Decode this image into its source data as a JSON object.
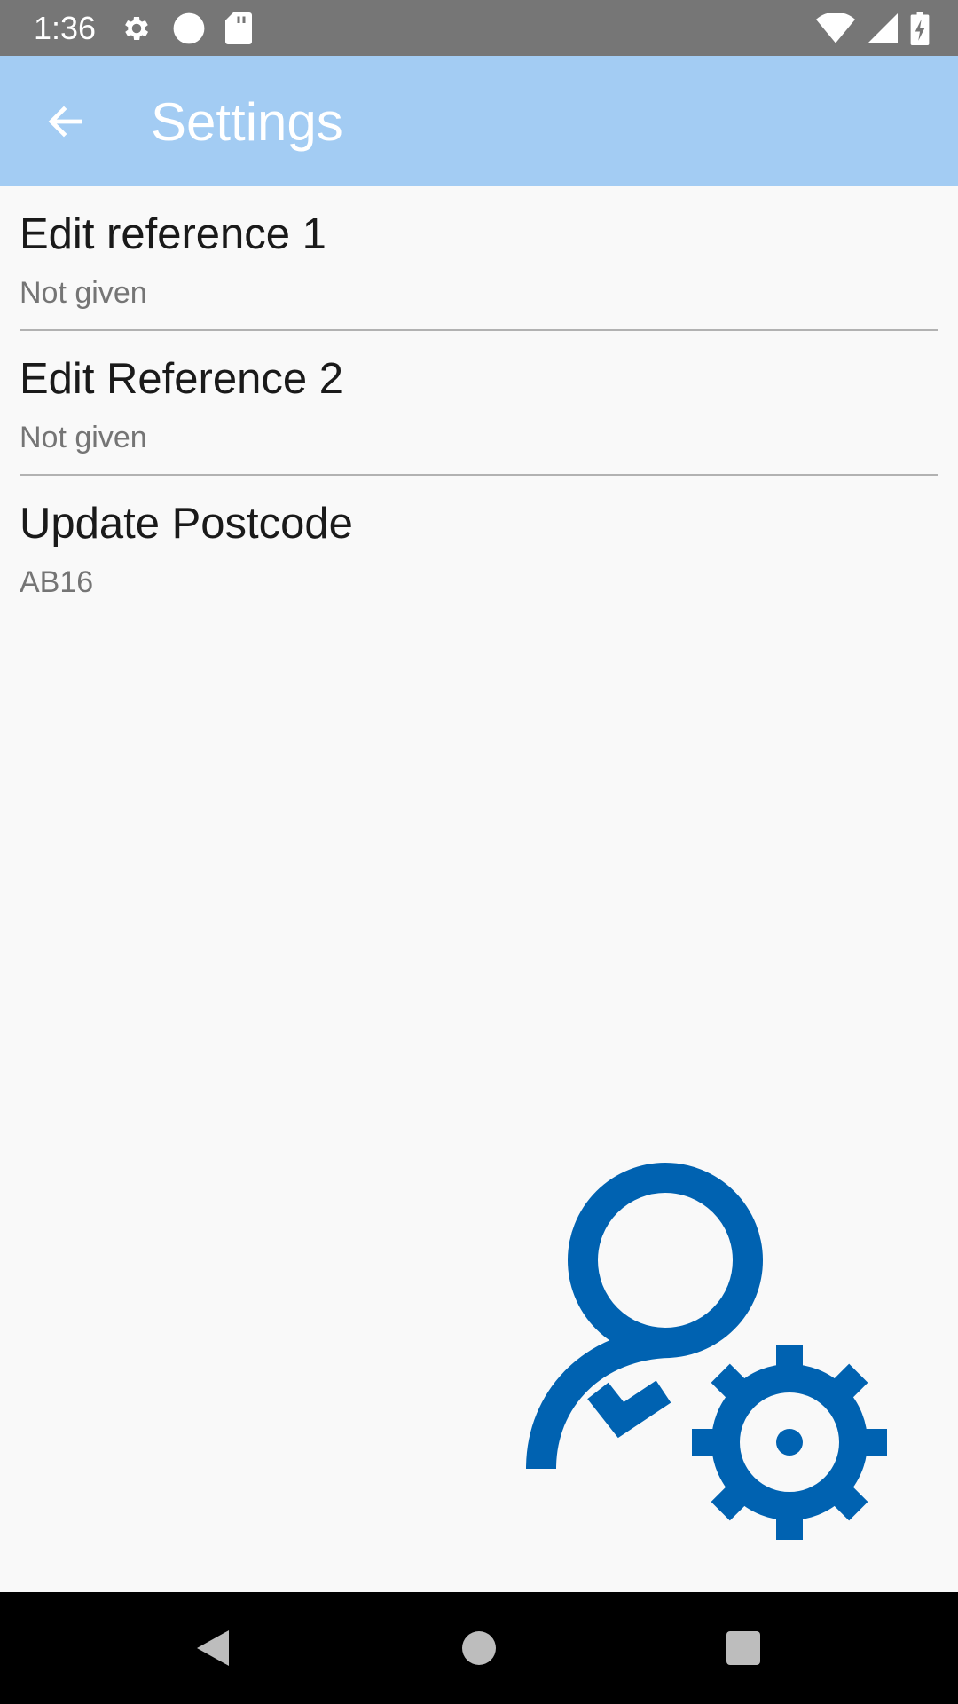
{
  "status_bar": {
    "time": "1:36",
    "icons": [
      "gear-icon",
      "circle-icon",
      "sd-card-icon",
      "wifi-icon",
      "signal-icon",
      "battery-icon"
    ]
  },
  "app_bar": {
    "title": "Settings",
    "back_icon": "arrow-left-icon",
    "background_color": "#a3ccf3"
  },
  "settings": {
    "items": [
      {
        "title": "Edit reference 1",
        "summary": "Not given"
      },
      {
        "title": "Edit Reference 2",
        "summary": "Not given"
      },
      {
        "title": "Update Postcode",
        "summary": "AB16"
      }
    ]
  },
  "illustration": {
    "icon": "user-settings-icon",
    "color": "#0062b1"
  },
  "nav_bar": {
    "icons": [
      "back-triangle-icon",
      "home-circle-icon",
      "recents-square-icon"
    ]
  }
}
